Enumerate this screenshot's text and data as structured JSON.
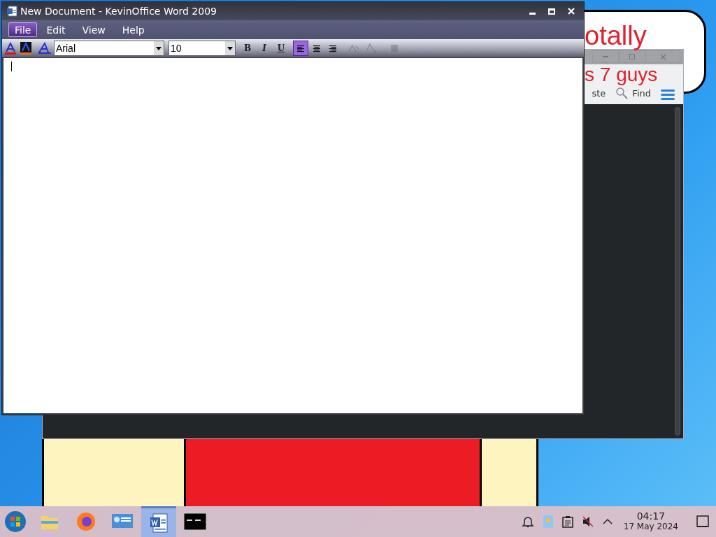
{
  "wallpaper": {
    "bubble_lines": [
      "otally",
      "s 7 guys"
    ]
  },
  "background_window": {
    "toolbar": [
      {
        "kind": "text",
        "label": "ste"
      },
      {
        "kind": "search",
        "label": "Find"
      },
      {
        "kind": "menu"
      }
    ]
  },
  "word_window": {
    "title": "New Document - KevinOffice Word 2009",
    "menu": [
      {
        "label": "File",
        "selected": true
      },
      {
        "label": "Edit",
        "selected": false
      },
      {
        "label": "View",
        "selected": false
      },
      {
        "label": "Help",
        "selected": false
      }
    ],
    "font": "Arial",
    "size": "10",
    "format_buttons": [
      {
        "kind": "bold",
        "label": "B"
      },
      {
        "kind": "italic",
        "label": "I"
      },
      {
        "kind": "underline",
        "label": "U"
      }
    ],
    "align_buttons": [
      {
        "kind": "left",
        "selected": true
      },
      {
        "kind": "center",
        "selected": false
      },
      {
        "kind": "right",
        "selected": false
      }
    ]
  },
  "taskbar": {
    "apps": [
      {
        "kind": "files",
        "selected": false
      },
      {
        "kind": "browser",
        "selected": false
      },
      {
        "kind": "display",
        "selected": false
      },
      {
        "kind": "word",
        "selected": true
      },
      {
        "kind": "terminal",
        "selected": false
      }
    ],
    "clock": {
      "time": "04:17",
      "date": "17 May 2024"
    }
  }
}
